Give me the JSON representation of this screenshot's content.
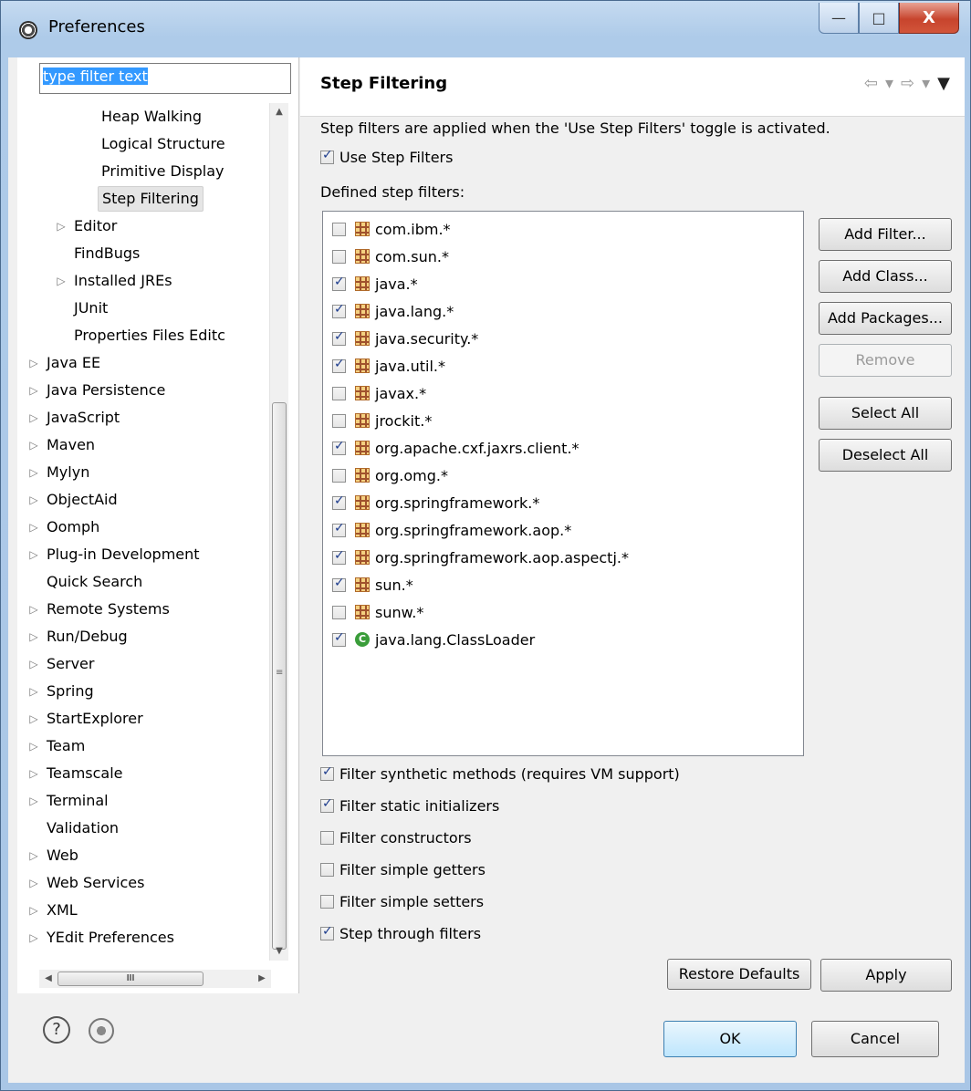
{
  "window": {
    "title": "Preferences",
    "minimize": "—",
    "maximize": "□",
    "close": "X"
  },
  "filter": {
    "value": "type filter text"
  },
  "tree": [
    {
      "label": "Heap Walking",
      "indent": 3,
      "arrow": ""
    },
    {
      "label": "Logical Structure",
      "indent": 3,
      "arrow": ""
    },
    {
      "label": "Primitive Display",
      "indent": 3,
      "arrow": ""
    },
    {
      "label": "Step Filtering",
      "indent": 3,
      "arrow": "",
      "selected": true
    },
    {
      "label": "Editor",
      "indent": 2,
      "arrow": "▷"
    },
    {
      "label": "FindBugs",
      "indent": 2,
      "arrow": ""
    },
    {
      "label": "Installed JREs",
      "indent": 2,
      "arrow": "▷"
    },
    {
      "label": "JUnit",
      "indent": 2,
      "arrow": ""
    },
    {
      "label": "Properties Files Editc",
      "indent": 2,
      "arrow": ""
    },
    {
      "label": "Java EE",
      "indent": 1,
      "arrow": "▷"
    },
    {
      "label": "Java Persistence",
      "indent": 1,
      "arrow": "▷"
    },
    {
      "label": "JavaScript",
      "indent": 1,
      "arrow": "▷"
    },
    {
      "label": "Maven",
      "indent": 1,
      "arrow": "▷"
    },
    {
      "label": "Mylyn",
      "indent": 1,
      "arrow": "▷"
    },
    {
      "label": "ObjectAid",
      "indent": 1,
      "arrow": "▷"
    },
    {
      "label": "Oomph",
      "indent": 1,
      "arrow": "▷"
    },
    {
      "label": "Plug-in Development",
      "indent": 1,
      "arrow": "▷"
    },
    {
      "label": "Quick Search",
      "indent": 1,
      "arrow": ""
    },
    {
      "label": "Remote Systems",
      "indent": 1,
      "arrow": "▷"
    },
    {
      "label": "Run/Debug",
      "indent": 1,
      "arrow": "▷"
    },
    {
      "label": "Server",
      "indent": 1,
      "arrow": "▷"
    },
    {
      "label": "Spring",
      "indent": 1,
      "arrow": "▷"
    },
    {
      "label": "StartExplorer",
      "indent": 1,
      "arrow": "▷"
    },
    {
      "label": "Team",
      "indent": 1,
      "arrow": "▷"
    },
    {
      "label": "Teamscale",
      "indent": 1,
      "arrow": "▷"
    },
    {
      "label": "Terminal",
      "indent": 1,
      "arrow": "▷"
    },
    {
      "label": "Validation",
      "indent": 1,
      "arrow": ""
    },
    {
      "label": "Web",
      "indent": 1,
      "arrow": "▷"
    },
    {
      "label": "Web Services",
      "indent": 1,
      "arrow": "▷"
    },
    {
      "label": "XML",
      "indent": 1,
      "arrow": "▷"
    },
    {
      "label": "YEdit Preferences",
      "indent": 1,
      "arrow": "▷"
    }
  ],
  "page": {
    "title": "Step Filtering",
    "description": "Step filters are applied when the 'Use Step Filters' toggle is activated.",
    "use_step_filters": {
      "label": "Use Step Filters",
      "checked": true
    },
    "defined_label": "Defined step filters:",
    "filters": [
      {
        "name": "com.ibm.*",
        "checked": false,
        "kind": "package"
      },
      {
        "name": "com.sun.*",
        "checked": false,
        "kind": "package"
      },
      {
        "name": "java.*",
        "checked": true,
        "kind": "package"
      },
      {
        "name": "java.lang.*",
        "checked": true,
        "kind": "package"
      },
      {
        "name": "java.security.*",
        "checked": true,
        "kind": "package"
      },
      {
        "name": "java.util.*",
        "checked": true,
        "kind": "package"
      },
      {
        "name": "javax.*",
        "checked": false,
        "kind": "package"
      },
      {
        "name": "jrockit.*",
        "checked": false,
        "kind": "package"
      },
      {
        "name": "org.apache.cxf.jaxrs.client.*",
        "checked": true,
        "kind": "package"
      },
      {
        "name": "org.omg.*",
        "checked": false,
        "kind": "package"
      },
      {
        "name": "org.springframework.*",
        "checked": true,
        "kind": "package"
      },
      {
        "name": "org.springframework.aop.*",
        "checked": true,
        "kind": "package"
      },
      {
        "name": "org.springframework.aop.aspectj.*",
        "checked": true,
        "kind": "package"
      },
      {
        "name": "sun.*",
        "checked": true,
        "kind": "package"
      },
      {
        "name": "sunw.*",
        "checked": false,
        "kind": "package"
      },
      {
        "name": "java.lang.ClassLoader",
        "checked": true,
        "kind": "class"
      }
    ],
    "side_buttons": [
      {
        "label": "Add Filter...",
        "name": "add-filter-button",
        "enabled": true
      },
      {
        "label": "Add Class...",
        "name": "add-class-button",
        "enabled": true
      },
      {
        "label": "Add Packages...",
        "name": "add-packages-button",
        "enabled": true
      },
      {
        "label": "Remove",
        "name": "remove-button",
        "enabled": false
      },
      {
        "label": "Select All",
        "name": "select-all-button",
        "enabled": true
      },
      {
        "label": "Deselect All",
        "name": "deselect-all-button",
        "enabled": true
      }
    ],
    "options": [
      {
        "label": "Filter synthetic methods (requires VM support)",
        "checked": true
      },
      {
        "label": "Filter static initializers",
        "checked": true
      },
      {
        "label": "Filter constructors",
        "checked": false
      },
      {
        "label": "Filter simple getters",
        "checked": false
      },
      {
        "label": "Filter simple setters",
        "checked": false
      },
      {
        "label": "Step through filters",
        "checked": true
      }
    ],
    "restore_defaults": "Restore Defaults",
    "apply": "Apply"
  },
  "dialog": {
    "ok": "OK",
    "cancel": "Cancel",
    "help_glyph": "?"
  },
  "icons": {
    "class_glyph": "C",
    "nav_back": "⇦",
    "nav_forward": "⇨",
    "nav_dropdown": "▾",
    "nav_menu": "▼",
    "scroll_up": "▲",
    "scroll_down": "▼",
    "scroll_left": "◀",
    "scroll_right": "▶",
    "scroll_grip": "III",
    "vscroll_grip": "≡"
  }
}
